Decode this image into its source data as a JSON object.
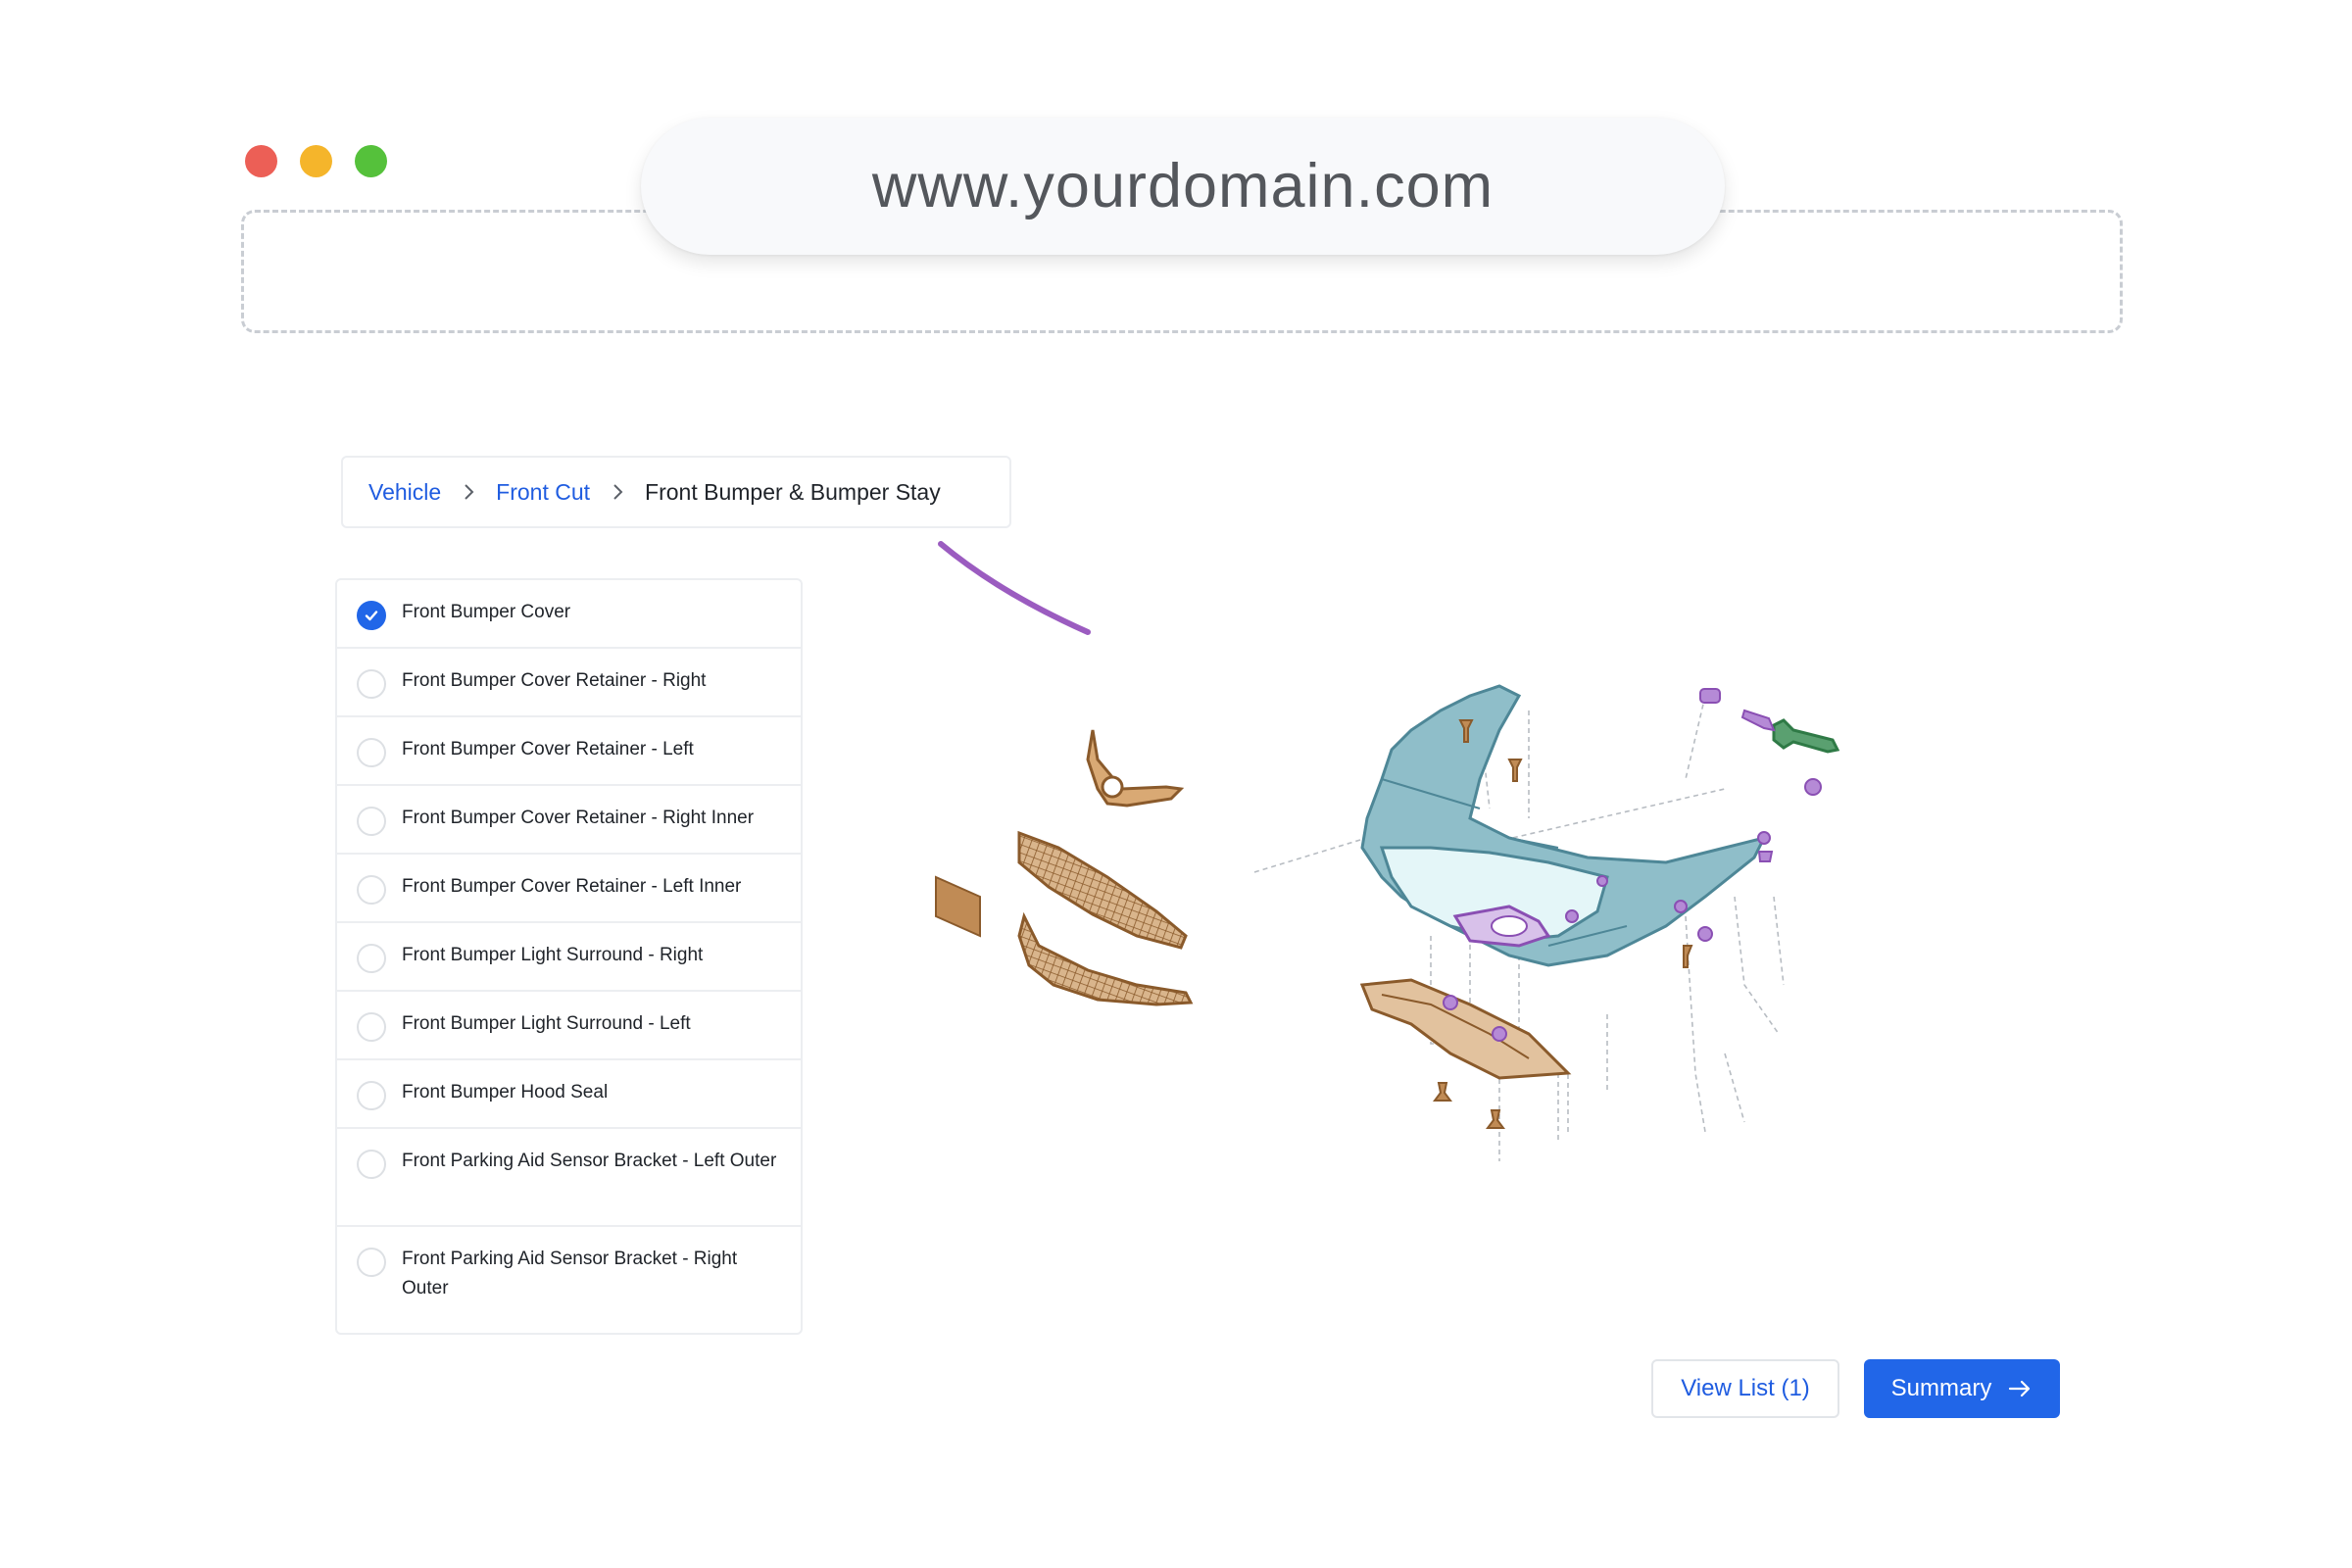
{
  "browser": {
    "url": "www.yourdomain.com",
    "window_controls": [
      "close",
      "minimize",
      "maximize"
    ],
    "colors": {
      "close": "#ec5f56",
      "minimize": "#f5b52b",
      "maximize": "#55c13b"
    }
  },
  "breadcrumb": {
    "items": [
      "Vehicle",
      "Front Cut"
    ],
    "current": "Front Bumper & Bumper Stay",
    "separator_icon": "chevron-right-icon"
  },
  "parts": [
    {
      "label": "Front Bumper Cover",
      "checked": true
    },
    {
      "label": "Front Bumper Cover Retainer - Right",
      "checked": false
    },
    {
      "label": "Front Bumper Cover Retainer - Left",
      "checked": false
    },
    {
      "label": "Front Bumper Cover Retainer - Right Inner",
      "checked": false
    },
    {
      "label": "Front Bumper Cover Retainer - Left Inner",
      "checked": false
    },
    {
      "label": "Front Bumper Light Surround - Right",
      "checked": false
    },
    {
      "label": "Front Bumper Light Surround - Left",
      "checked": false
    },
    {
      "label": "Front Bumper Hood Seal",
      "checked": false
    },
    {
      "label": "Front Parking Aid Sensor Bracket - Left Outer",
      "checked": false
    },
    {
      "label": "Front Parking Aid Sensor Bracket - Right Outer",
      "checked": false
    }
  ],
  "actions": {
    "view_list": "View List (1)",
    "summary": "Summary",
    "summary_icon": "arrow-right-icon"
  },
  "diagram": {
    "name": "front-bumper-exploded-view",
    "colors": {
      "bumper": "#7fb3c1",
      "orange_parts": "#c08b55",
      "purple_parts": "#9b5cc0",
      "green_parts": "#2f7a46"
    }
  },
  "colors": {
    "accent": "#2166e8",
    "link": "#1f5ce0",
    "border": "#eceef1"
  }
}
